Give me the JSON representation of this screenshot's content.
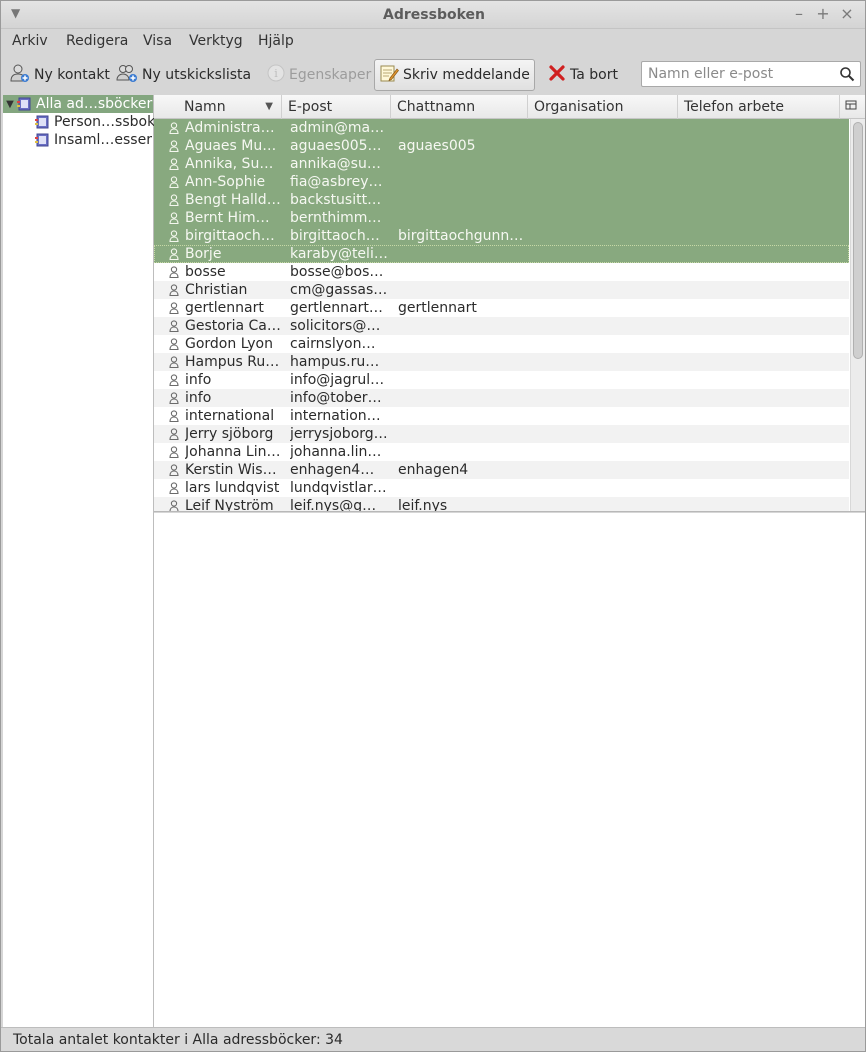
{
  "window": {
    "title": "Adressboken"
  },
  "menubar": [
    "Arkiv",
    "Redigera",
    "Visa",
    "Verktyg",
    "Hjälp"
  ],
  "toolbar": {
    "new_contact": "Ny kontakt",
    "new_list": "Ny utskickslista",
    "properties": "Egenskaper",
    "write": "Skriv meddelande",
    "delete": "Ta bort"
  },
  "search": {
    "placeholder": "Namn eller e-post"
  },
  "sidebar": {
    "items": [
      {
        "label": "Alla ad…sböcker"
      },
      {
        "label": "Person…ssbok"
      },
      {
        "label": "Insaml…esser"
      }
    ]
  },
  "columns": [
    "Namn",
    "E-post",
    "Chattnamn",
    "Organisation",
    "Telefon arbete"
  ],
  "contacts": [
    {
      "name": "Administraci…",
      "email": "admin@mast…",
      "chat": ""
    },
    {
      "name": "Aguaes Mur…",
      "email": "aguaes005@…",
      "chat": "aguaes005"
    },
    {
      "name": "Annika, Sun…",
      "email": "annika@sun…",
      "chat": ""
    },
    {
      "name": "Ann-Sophie",
      "email": "fia@asbreye…",
      "chat": ""
    },
    {
      "name": "Bengt Halldén",
      "email": "backstusittar…",
      "chat": ""
    },
    {
      "name": "Bernt Himmer",
      "email": "bernthimmer…",
      "chat": ""
    },
    {
      "name": "birgittaochg…",
      "email": "birgittaochgu…",
      "chat": "birgittaochgunnar…"
    },
    {
      "name": "Borje",
      "email": "karaby@teli…",
      "chat": ""
    },
    {
      "name": "bosse",
      "email": "bosse@boss…",
      "chat": ""
    },
    {
      "name": "Christian",
      "email": "cm@gassas.se",
      "chat": ""
    },
    {
      "name": "gertlennart",
      "email": "gertlennart@…",
      "chat": "gertlennart"
    },
    {
      "name": "Gestoria Car…",
      "email": "solicitors@g…",
      "chat": ""
    },
    {
      "name": "Gordon Lyon",
      "email": "cairnslyon@…",
      "chat": ""
    },
    {
      "name": "Hampus Run…",
      "email": "hampus.rund…",
      "chat": ""
    },
    {
      "name": "info",
      "email": "info@jagrull…",
      "chat": ""
    },
    {
      "name": "info",
      "email": "info@tobera.…",
      "chat": ""
    },
    {
      "name": "international",
      "email": "international…",
      "chat": ""
    },
    {
      "name": "Jerry sjöborg",
      "email": "jerrysjoborg…",
      "chat": ""
    },
    {
      "name": "Johanna Lindh",
      "email": "johanna.lind…",
      "chat": ""
    },
    {
      "name": "Kerstin Wise…",
      "email": "enhagen4@g…",
      "chat": "enhagen4"
    },
    {
      "name": "lars lundqvist",
      "email": "lundqvistlars…",
      "chat": ""
    },
    {
      "name": "Leif Nyström",
      "email": "leif.nys@gm…",
      "chat": "leif.nys"
    }
  ],
  "status": {
    "text": "Totala antalet kontakter i Alla adressböcker: 34"
  }
}
